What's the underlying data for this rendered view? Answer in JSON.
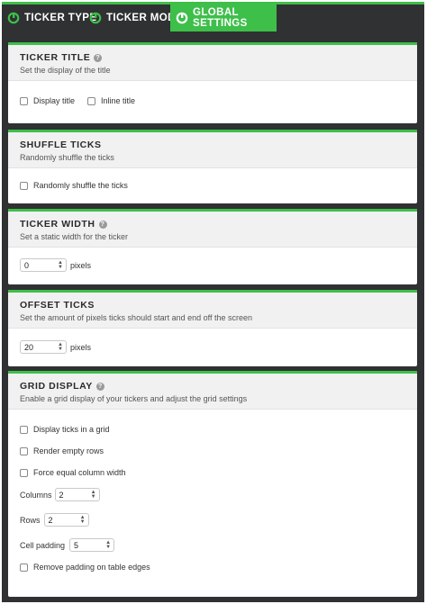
{
  "tabs": [
    {
      "label": "TICKER TYPE",
      "active": false,
      "icon": "ticker-logo-icon"
    },
    {
      "label": "TICKER MODE",
      "active": false,
      "icon": "ticker-logo-icon"
    },
    {
      "label": "GLOBAL SETTINGS",
      "active": true,
      "icon": "ticker-logo-icon"
    }
  ],
  "colors": {
    "accent": "#3dbf4a",
    "frame": "#2f3132"
  },
  "ticker_title": {
    "title": "TICKER TITLE",
    "desc": "Set the display of the title",
    "options": [
      "Display title",
      "Inline title"
    ]
  },
  "shuffle": {
    "title": "SHUFFLE TICKS",
    "desc": "Randomly shuffle the ticks",
    "option": "Randomly shuffle the ticks"
  },
  "width": {
    "title": "TICKER WIDTH",
    "desc": "Set a static width for the ticker",
    "value": "0",
    "unit": "pixels"
  },
  "offset": {
    "title": "OFFSET TICKS",
    "desc": "Set the amount of pixels ticks should start and end off the screen",
    "value": "20",
    "unit": "pixels"
  },
  "grid": {
    "title": "GRID DISPLAY",
    "desc": "Enable a grid display of your tickers and adjust the grid settings",
    "options": [
      "Display ticks in a grid",
      "Render empty rows",
      "Force equal column width"
    ],
    "columns_label": "Columns",
    "columns_value": "2",
    "rows_label": "Rows",
    "rows_value": "2",
    "padding_label": "Cell padding",
    "padding_value": "5",
    "edges_option": "Remove padding on table edges"
  }
}
